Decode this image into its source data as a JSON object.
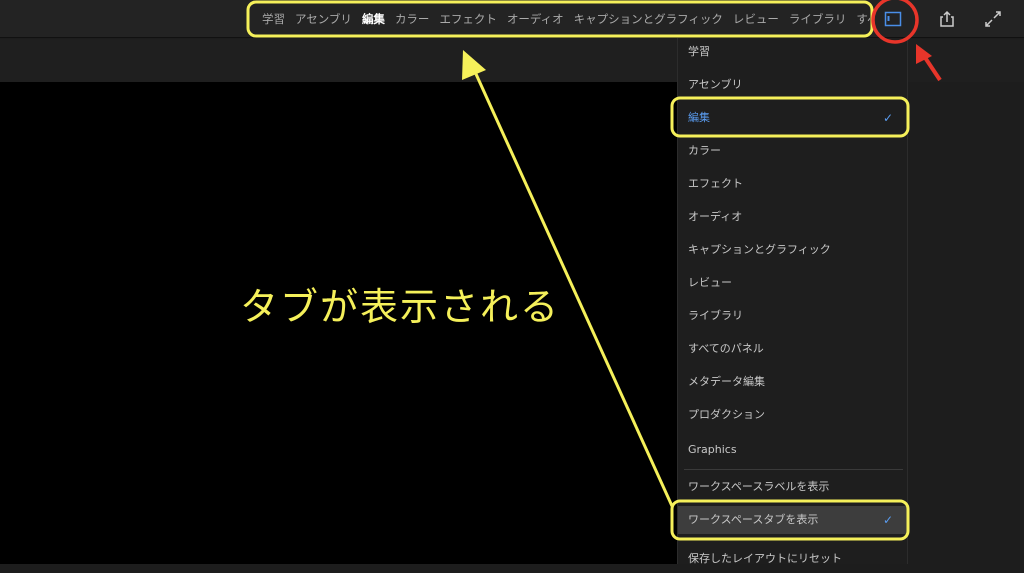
{
  "tabs": [
    "学習",
    "アセンブリ",
    "編集",
    "カラー",
    "エフェクト",
    "オーディオ",
    "キャプションとグラフィック",
    "レビュー",
    "ライブラリ",
    "すべて"
  ],
  "active_tab": "編集",
  "icons": {
    "workspace": "workspace-panel-icon",
    "share": "share-icon",
    "fullscreen": "expand-icon"
  },
  "menu": {
    "items": [
      "学習",
      "アセンブリ",
      "編集",
      "カラー",
      "エフェクト",
      "オーディオ",
      "キャプションとグラフィック",
      "レビュー",
      "ライブラリ",
      "すべてのパネル",
      "メタデータ編集",
      "プロダクション",
      "Graphics"
    ],
    "selected": "編集",
    "options": [
      "ワークスペースラベルを表示",
      "ワークスペースタブを表示",
      "保存したレイアウトにリセット"
    ]
  },
  "annotation": "タブが表示される",
  "colors": {
    "highlight": "#f5f05a",
    "circle": "#e8352a",
    "accent": "#5a9cf0"
  }
}
